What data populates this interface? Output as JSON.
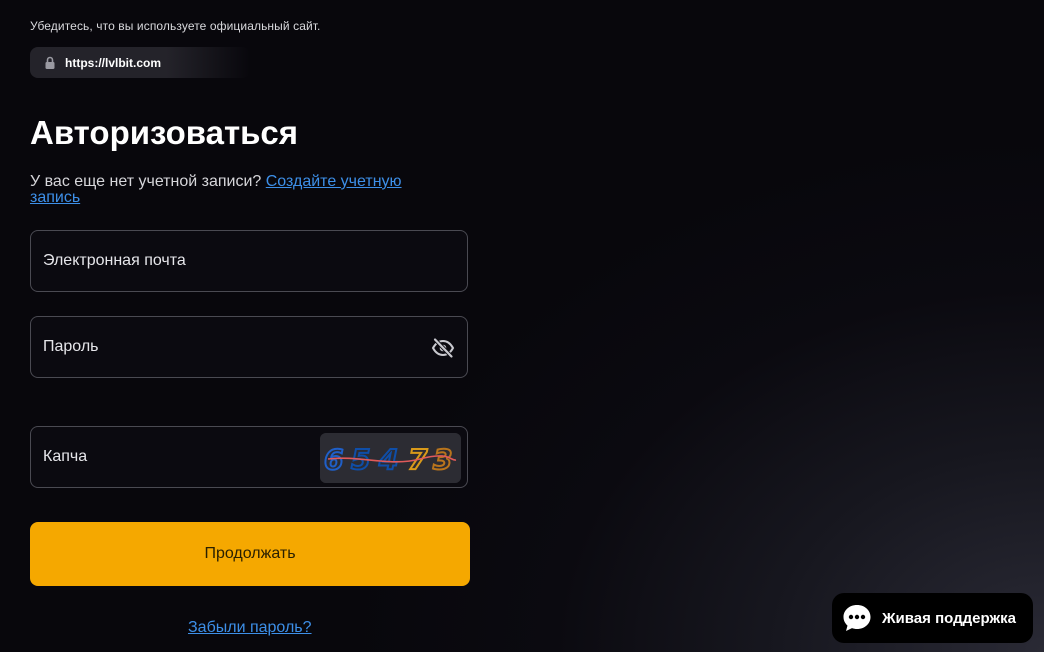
{
  "security_notice": {
    "text": "Убедитесь, что вы используете официальный сайт.",
    "url": "https://lvlbit.com",
    "lock_icon": "lock-icon"
  },
  "login": {
    "title": "Авторизоваться",
    "signup_prompt": "У вас еще нет учетной записи?",
    "signup_link": "Создайте учетную запись",
    "email_label": "Электронная почта",
    "password_label": "Пароль",
    "password_toggle_icon": "eye-slash-icon",
    "captcha_label": "Капча",
    "captcha_code": "65473",
    "continue_label": "Продолжать",
    "forgot_password": "Забыли пароль?"
  },
  "support": {
    "label": "Живая поддержка",
    "icon": "chat-bubble-icon"
  },
  "colors": {
    "accent": "#f5a800",
    "link": "#3d8fe8",
    "background": "#0b0a10",
    "field_border": "#4a4a52"
  }
}
